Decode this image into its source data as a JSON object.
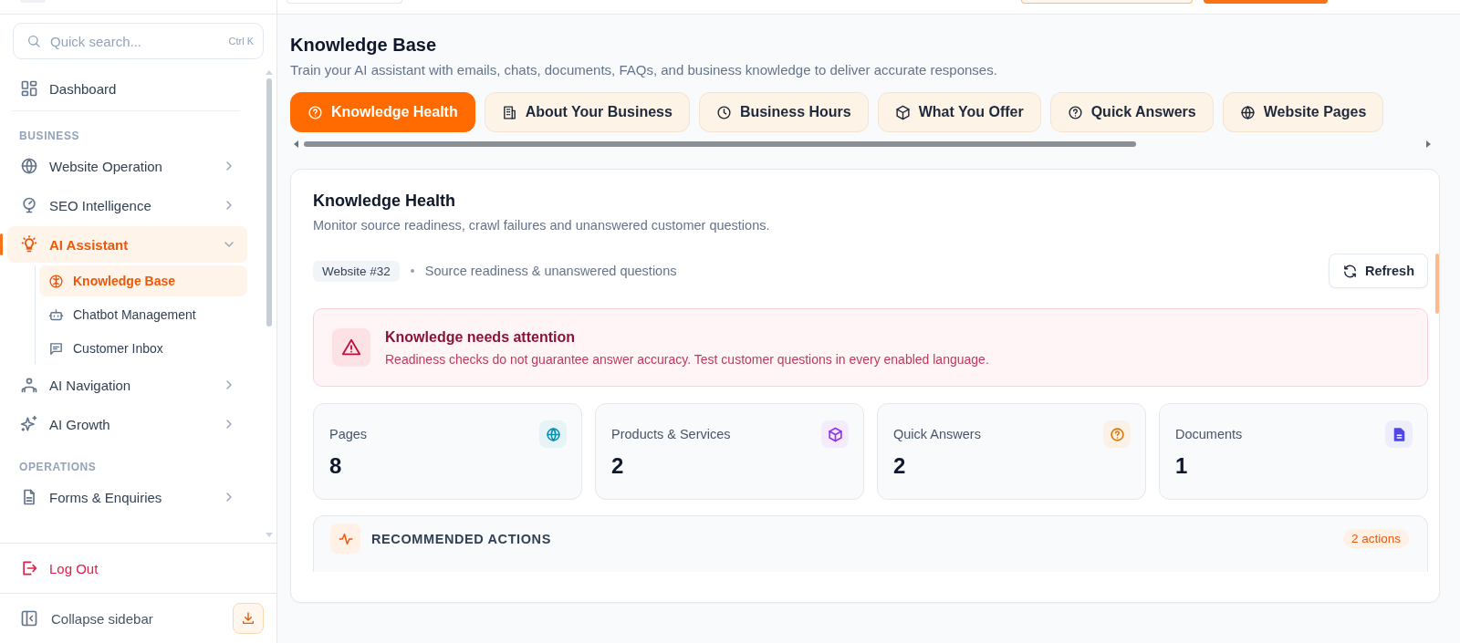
{
  "sidebar": {
    "search": {
      "placeholder": "Quick search...",
      "shortcut": "Ctrl K"
    },
    "nav": [
      {
        "kind": "item",
        "label": "Dashboard",
        "selected": false
      },
      {
        "kind": "section",
        "label": "BUSINESS"
      },
      {
        "kind": "item",
        "label": "Website Operation",
        "selected": false,
        "expanded": false
      },
      {
        "kind": "item",
        "label": "SEO Intelligence",
        "selected": false,
        "expanded": false
      },
      {
        "kind": "item",
        "label": "AI Assistant",
        "selected": true,
        "expanded": true,
        "children": [
          {
            "label": "Knowledge Base",
            "selected": true
          },
          {
            "label": "Chatbot Management",
            "selected": false
          },
          {
            "label": "Customer Inbox",
            "selected": false
          }
        ]
      },
      {
        "kind": "item",
        "label": "AI Navigation",
        "selected": false,
        "expanded": false
      },
      {
        "kind": "item",
        "label": "AI Growth",
        "selected": false,
        "expanded": false
      },
      {
        "kind": "section",
        "label": "OPERATIONS"
      },
      {
        "kind": "item",
        "label": "Forms & Enquiries",
        "selected": false,
        "expanded": false
      }
    ],
    "logout": "Log Out",
    "collapse": "Collapse sidebar"
  },
  "page": {
    "title": "Knowledge Base",
    "subtitle": "Train your AI assistant with emails, chats, documents, FAQs, and business knowledge to deliver accurate responses.",
    "tabs": [
      {
        "label": "Knowledge Health",
        "selected": true
      },
      {
        "label": "About Your Business",
        "selected": false
      },
      {
        "label": "Business Hours",
        "selected": false
      },
      {
        "label": "What You Offer",
        "selected": false
      },
      {
        "label": "Quick Answers",
        "selected": false
      },
      {
        "label": "Website Pages",
        "selected": false
      }
    ]
  },
  "card": {
    "title": "Knowledge Health",
    "description": "Monitor source readiness, crawl failures and unanswered customer questions.",
    "website": "Website #32",
    "meta": "Source readiness & unanswered questions",
    "refresh": "Refresh",
    "alert": {
      "title": "Knowledge needs attention",
      "message": "Readiness checks do not guarantee answer accuracy. Test customer questions in every enabled language."
    },
    "stats": [
      {
        "label": "Pages",
        "value": "8",
        "color": "#0891b2"
      },
      {
        "label": "Products & Services",
        "value": "2",
        "color": "#9333ea"
      },
      {
        "label": "Quick Answers",
        "value": "2",
        "color": "#d97706"
      },
      {
        "label": "Documents",
        "value": "1",
        "color": "#4f46e5"
      }
    ],
    "recommended": {
      "title": "RECOMMENDED ACTIONS",
      "count": "2 actions"
    }
  }
}
